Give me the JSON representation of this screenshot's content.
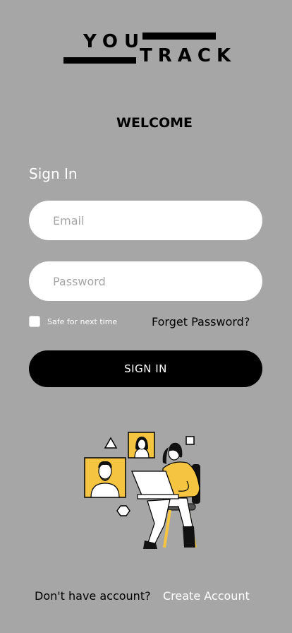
{
  "logo": {
    "word1": "YOU",
    "word2": "TRACK"
  },
  "welcome": "WELCOME",
  "signin_heading": "Sign In",
  "email": {
    "placeholder": "Email",
    "value": ""
  },
  "password": {
    "placeholder": "Password",
    "value": ""
  },
  "remember_label": "Safe for next time",
  "forget_label": "Forget Password?",
  "signin_button": "SIGN IN",
  "footer": {
    "question": "Don't have account?",
    "create_label": "Create Account"
  },
  "colors": {
    "background": "#a6a6a6",
    "accent": "#f5c542",
    "button": "#000000",
    "field": "#ffffff"
  }
}
